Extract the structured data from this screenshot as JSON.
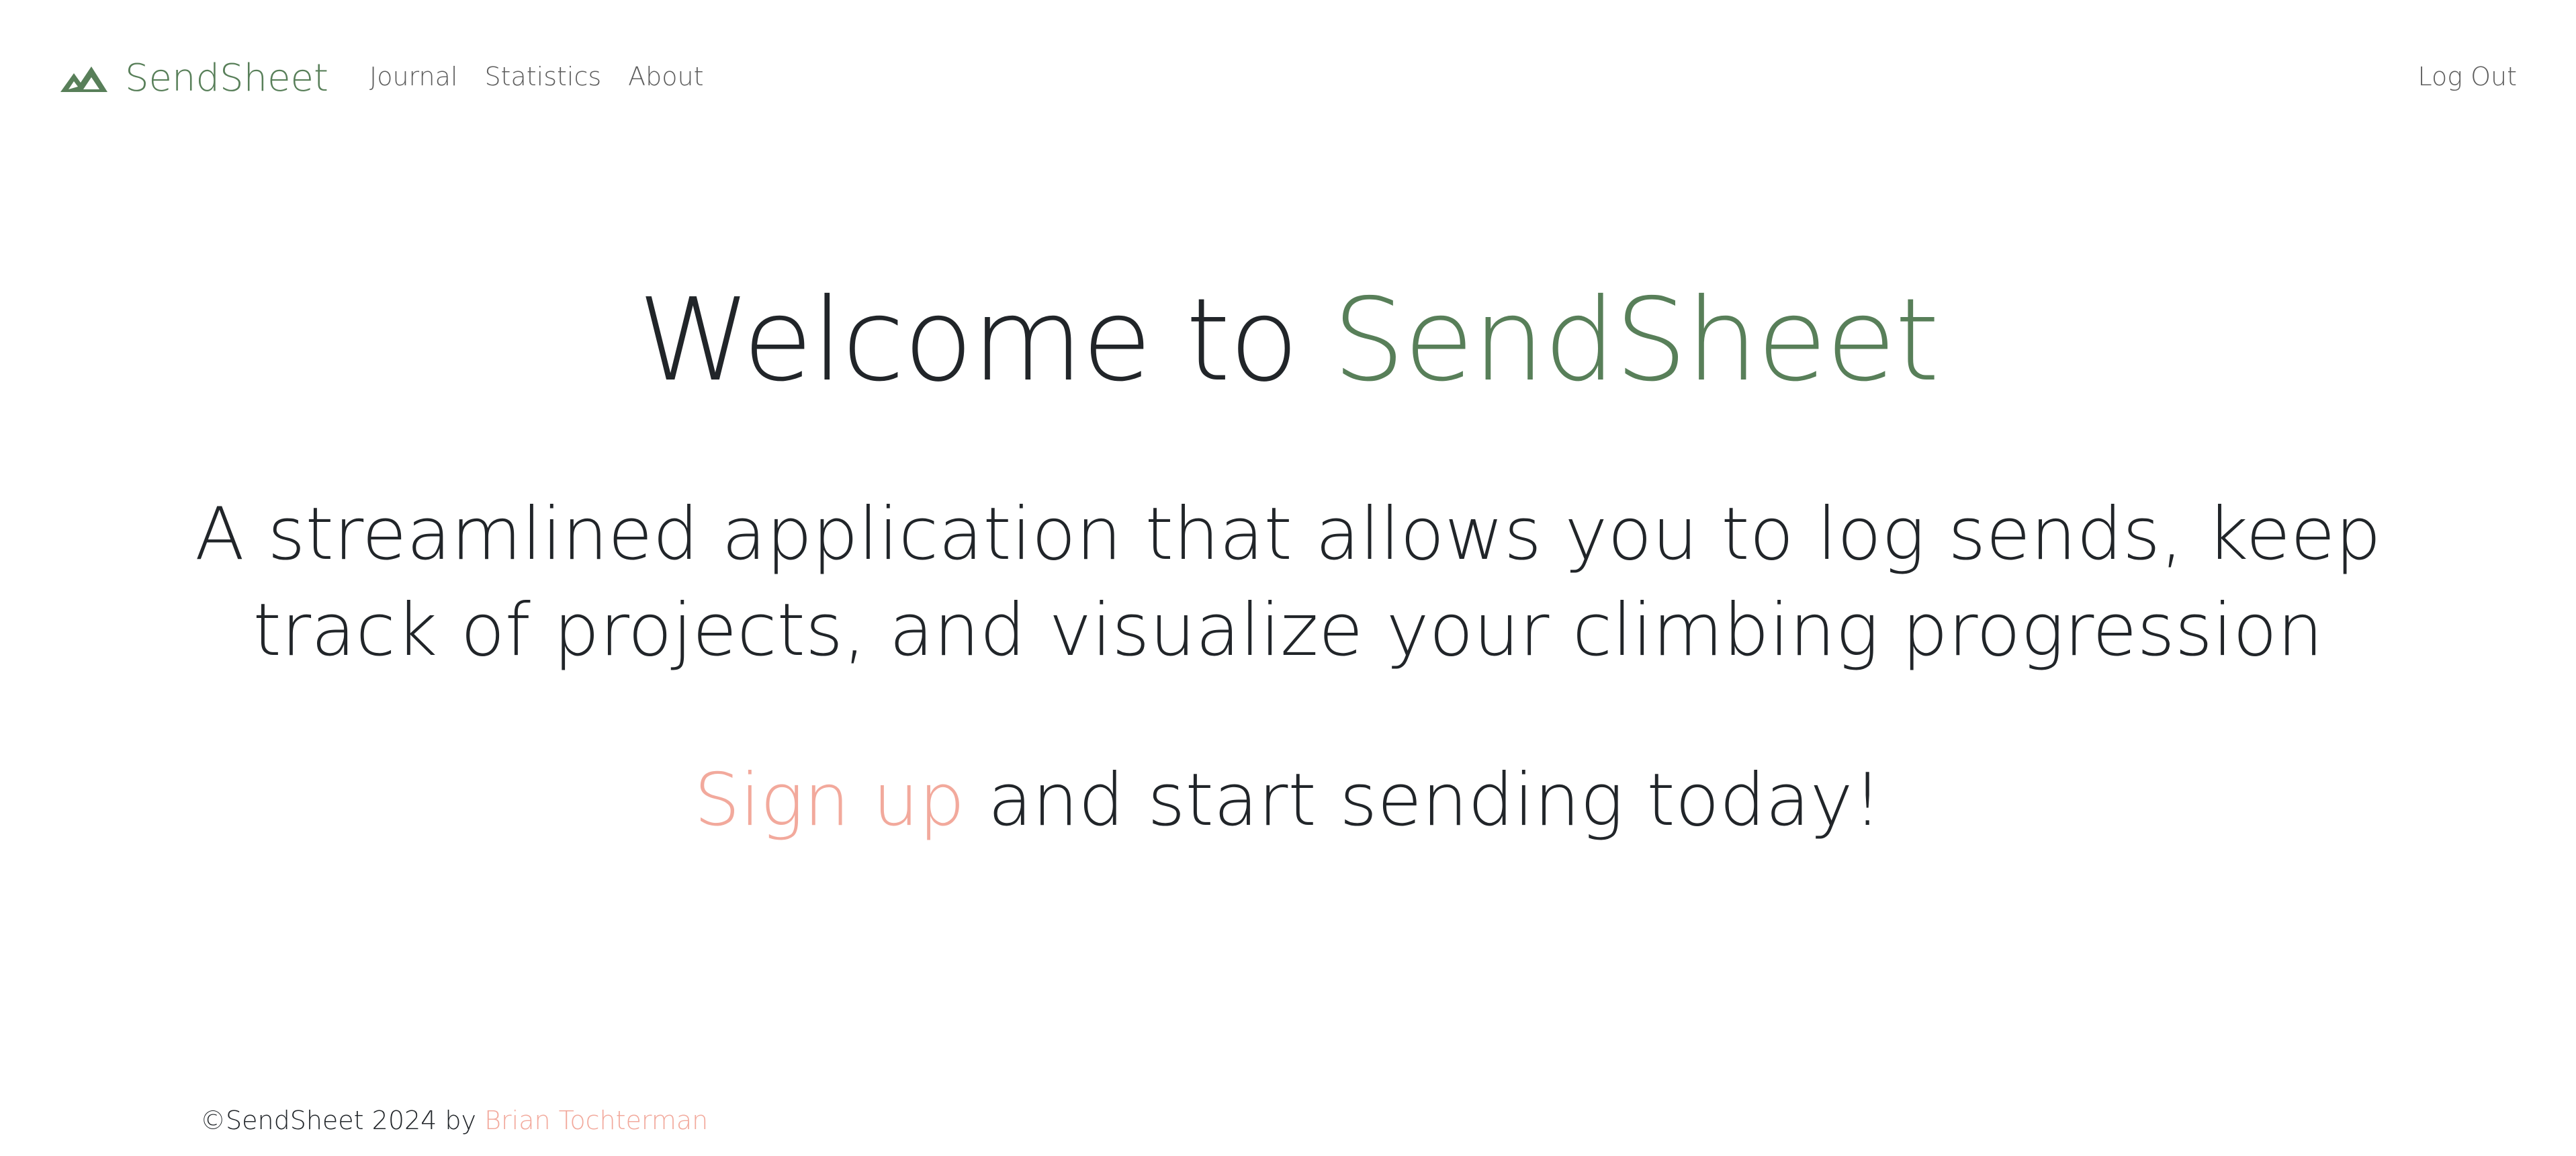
{
  "navbar": {
    "brand": {
      "icon": "mountain-icon",
      "name": "SendSheet"
    },
    "links": [
      {
        "label": "Journal"
      },
      {
        "label": "Statistics"
      },
      {
        "label": "About"
      }
    ],
    "logout_label": "Log Out"
  },
  "hero": {
    "title_prefix": "Welcome to ",
    "title_accent": "SendSheet",
    "subtitle": "A streamlined application that allows you to log sends, keep track of projects, and visualize your climbing progression",
    "cta_link": "Sign up",
    "cta_rest": " and start sending today!"
  },
  "footer": {
    "copyright": "©SendSheet 2024 by ",
    "author": "Brian Tochterman"
  },
  "colors": {
    "brand_green": "#587f59",
    "accent_salmon": "#f2a99c",
    "text_dark": "#212529",
    "nav_text": "#5d5d5d"
  }
}
